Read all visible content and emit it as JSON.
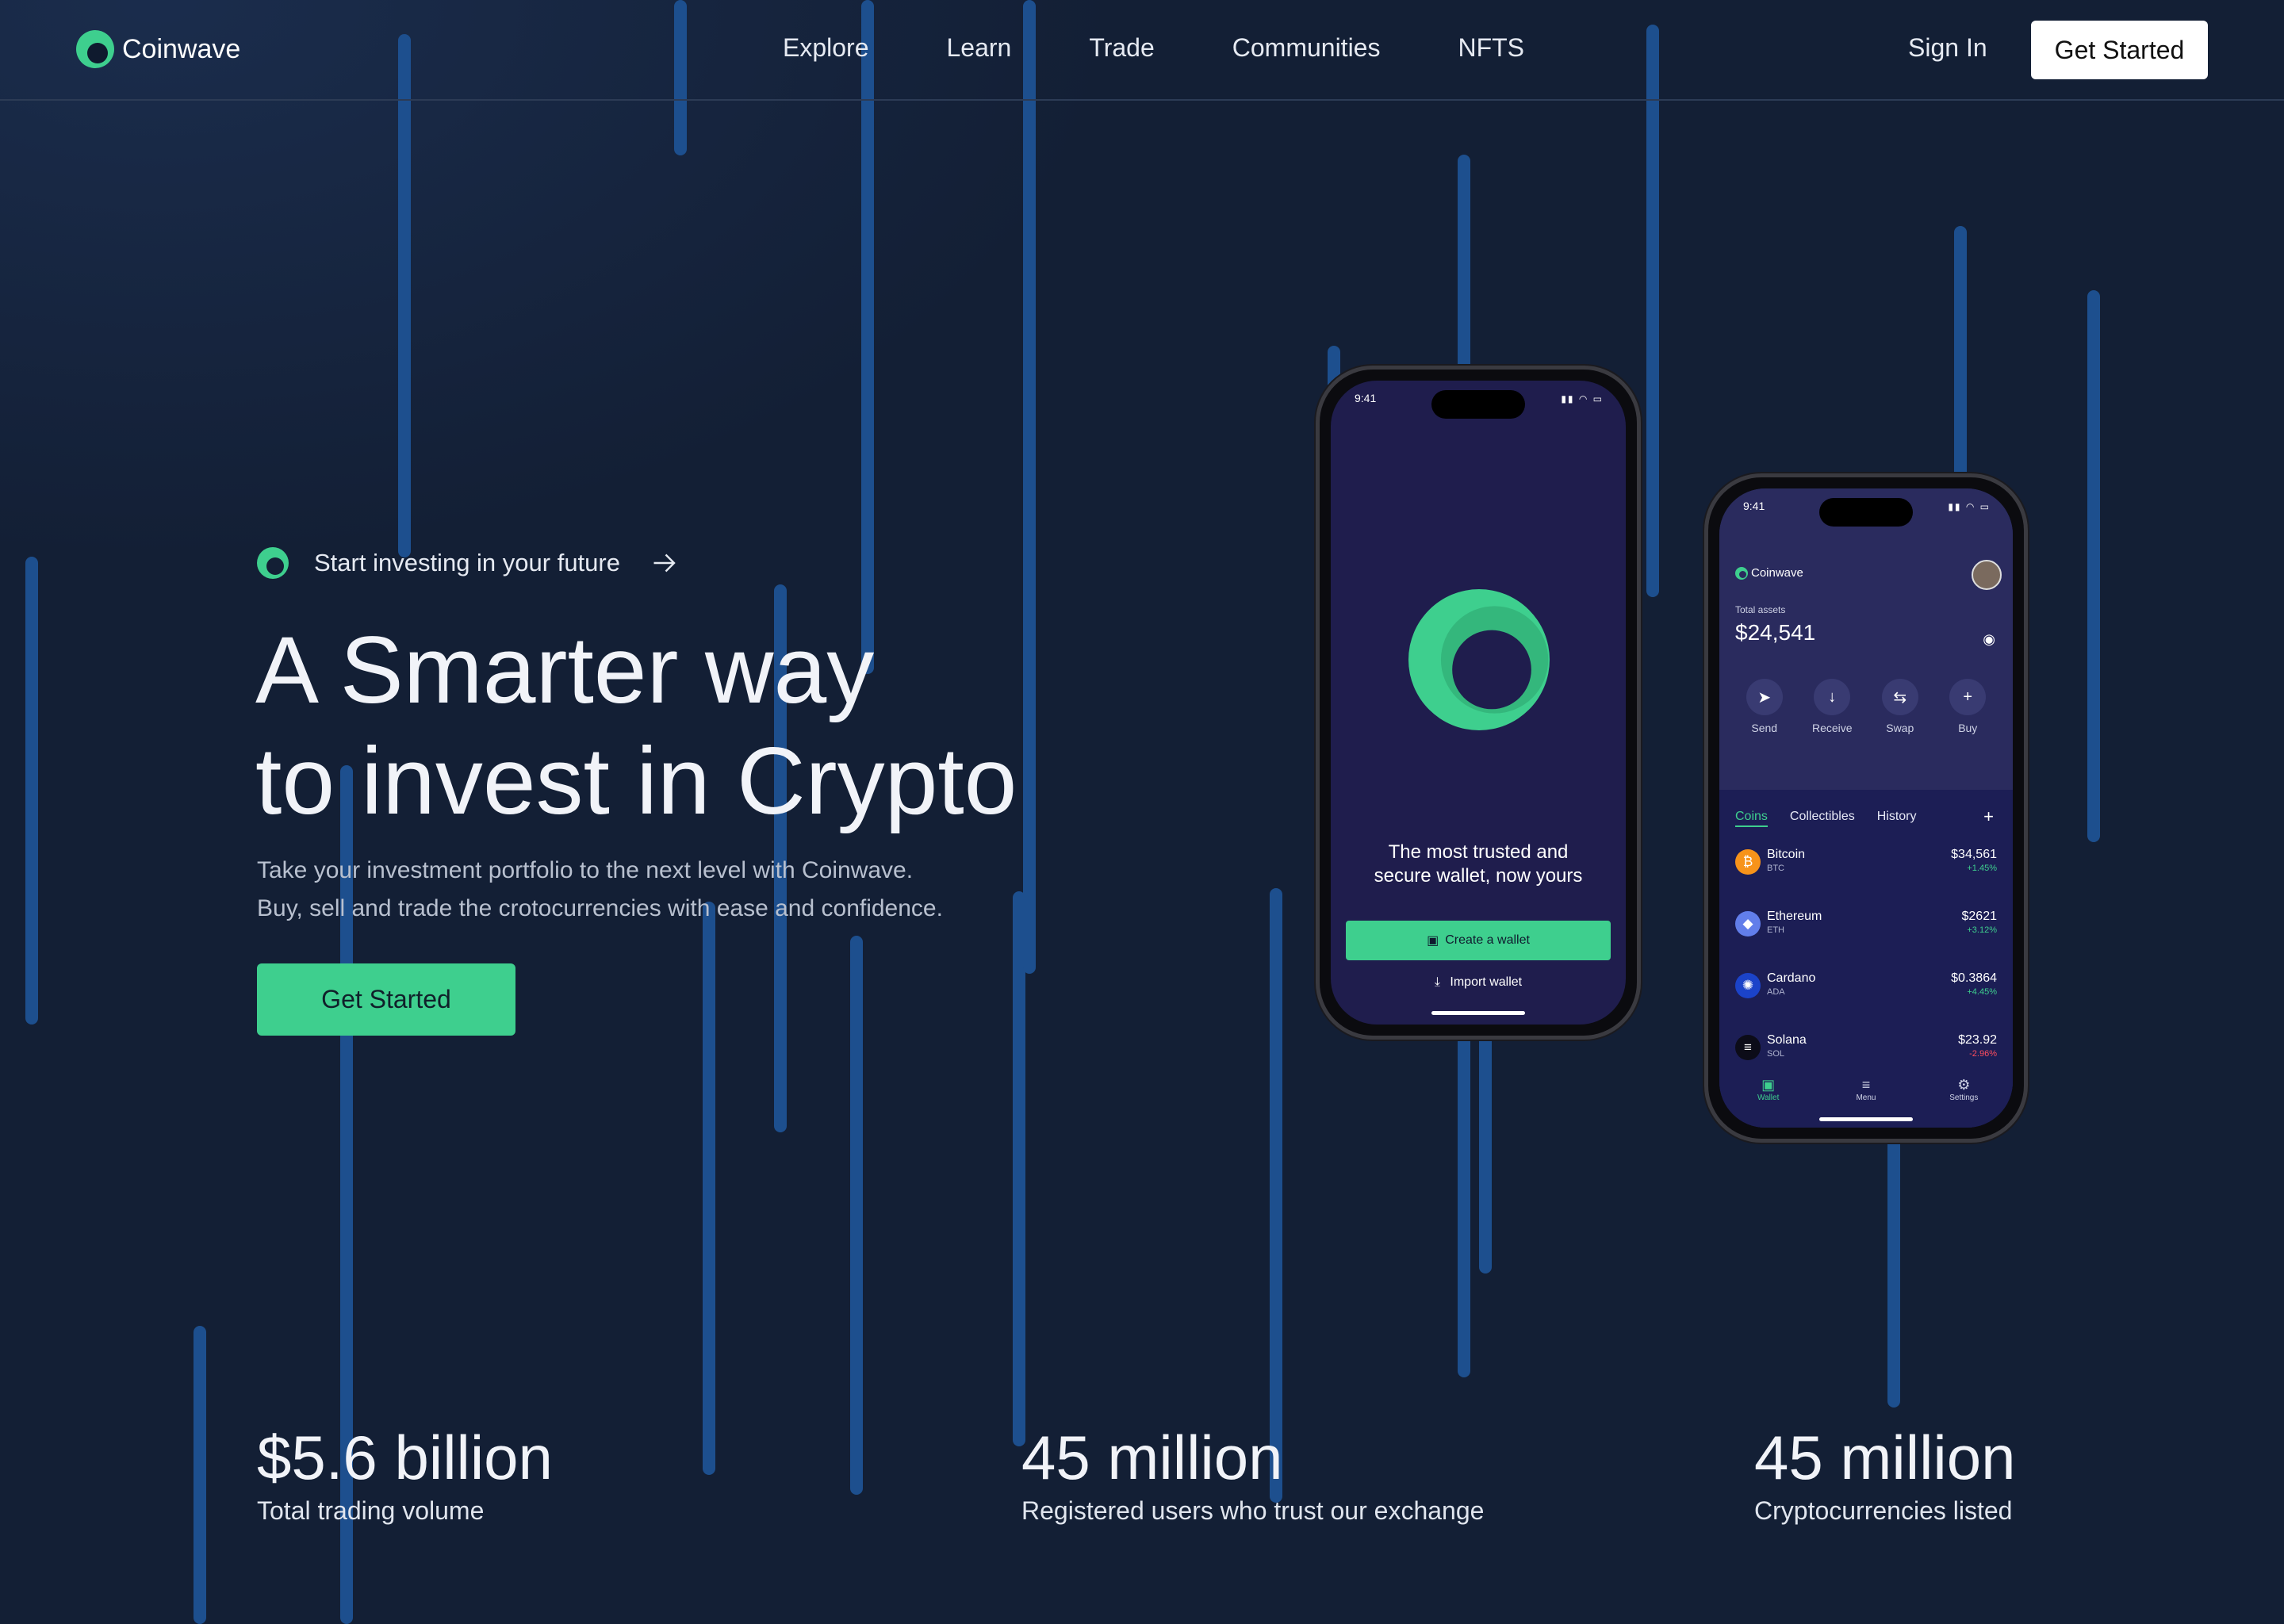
{
  "brand": {
    "name": "Coinwave",
    "accent": "#3ecf8e",
    "background": "#131f35",
    "line_color": "#1d4f8e"
  },
  "nav": {
    "links": [
      "Explore",
      "Learn",
      "Trade",
      "Communities",
      "NFTS"
    ],
    "sign_in": "Sign In",
    "cta": "Get Started"
  },
  "hero": {
    "eyebrow": "Start investing in your future",
    "title_line1": "A Smarter way",
    "title_line2": "to invest in Crypto",
    "subtitle_line1": "Take your investment portfolio to the next level with Coinwave.",
    "subtitle_line2": "Buy, sell and trade the crotocurrencies with ease and confidence.",
    "cta": "Get Started"
  },
  "stats": [
    {
      "value": "$5.6 billion",
      "label": "Total trading volume"
    },
    {
      "value": "45 million",
      "label": "Registered users who trust our exchange"
    },
    {
      "value": "45 million",
      "label": "Cryptocurrencies listed"
    }
  ],
  "phone_onboarding": {
    "time": "9:41",
    "tagline_line1": "The most trusted and",
    "tagline_line2": "secure wallet, now yours",
    "create_button": "Create a wallet",
    "import_link": "Import wallet"
  },
  "phone_wallet": {
    "time": "9:41",
    "brand": "Coinwave",
    "total_assets_label": "Total assets",
    "total_assets_value": "$24,541",
    "actions": [
      "Send",
      "Receive",
      "Swap",
      "Buy"
    ],
    "tabs": [
      "Coins",
      "Collectibles",
      "History"
    ],
    "coins": [
      {
        "name": "Bitcoin",
        "ticker": "BTC",
        "price": "$34,561",
        "change": "+1.45%",
        "color": "#f7931a",
        "positive": true
      },
      {
        "name": "Ethereum",
        "ticker": "ETH",
        "price": "$2621",
        "change": "+3.12%",
        "color": "#627eea",
        "positive": true
      },
      {
        "name": "Cardano",
        "ticker": "ADA",
        "price": "$0.3864",
        "change": "+4.45%",
        "color": "#1b43c9",
        "positive": true
      },
      {
        "name": "Solana",
        "ticker": "SOL",
        "price": "$23.92",
        "change": "-2.96%",
        "color": "#0c0c18",
        "positive": false
      }
    ],
    "tabbar": [
      "Wallet",
      "Menu",
      "Settings"
    ]
  }
}
